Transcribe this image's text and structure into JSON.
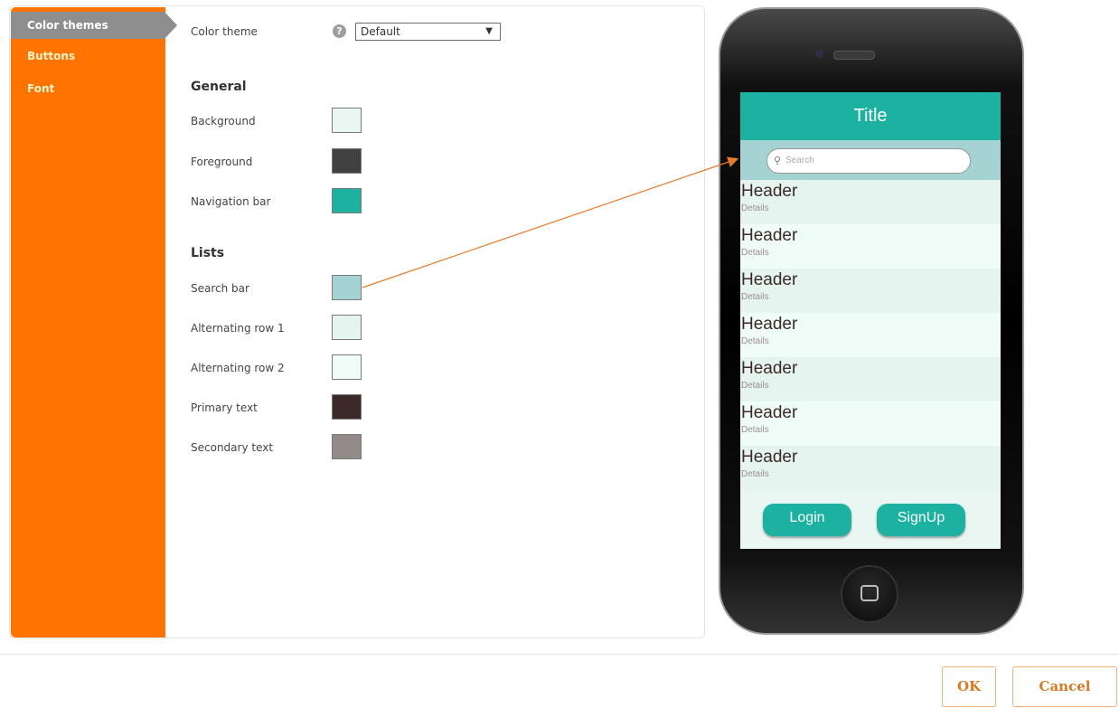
{
  "sidebar": {
    "items": [
      {
        "label": "Color themes",
        "active": true
      },
      {
        "label": "Buttons",
        "active": false
      },
      {
        "label": "Font",
        "active": false
      }
    ]
  },
  "theme": {
    "label": "Color theme",
    "help_icon": "?",
    "selected": "Default",
    "arrow": "▼"
  },
  "general": {
    "heading": "General",
    "items": [
      {
        "label": "Background",
        "color": "#e9f6f2"
      },
      {
        "label": "Foreground",
        "color": "#414141"
      },
      {
        "label": "Navigation bar",
        "color": "#1cb1a0"
      }
    ]
  },
  "lists": {
    "heading": "Lists",
    "items": [
      {
        "label": "Search bar",
        "color": "#a5d2d2"
      },
      {
        "label": "Alternating row 1",
        "color": "#e6f4f0"
      },
      {
        "label": "Alternating row 2",
        "color": "#f0fcf8"
      },
      {
        "label": "Primary text",
        "color": "#3b2a27"
      },
      {
        "label": "Secondary text",
        "color": "#938a8a"
      }
    ]
  },
  "preview": {
    "title": "Title",
    "search_placeholder": "Search",
    "rows": [
      {
        "header": "Header",
        "details": "Details"
      },
      {
        "header": "Header",
        "details": "Details"
      },
      {
        "header": "Header",
        "details": "Details"
      },
      {
        "header": "Header",
        "details": "Details"
      },
      {
        "header": "Header",
        "details": "Details"
      },
      {
        "header": "Header",
        "details": "Details"
      },
      {
        "header": "Header",
        "details": "Details"
      }
    ],
    "login": "Login",
    "signup": "SignUp"
  },
  "footer": {
    "ok": "OK",
    "cancel": "Cancel"
  },
  "accent": {
    "sidebar": "#ff7300",
    "arrow": "#e87a2a"
  }
}
